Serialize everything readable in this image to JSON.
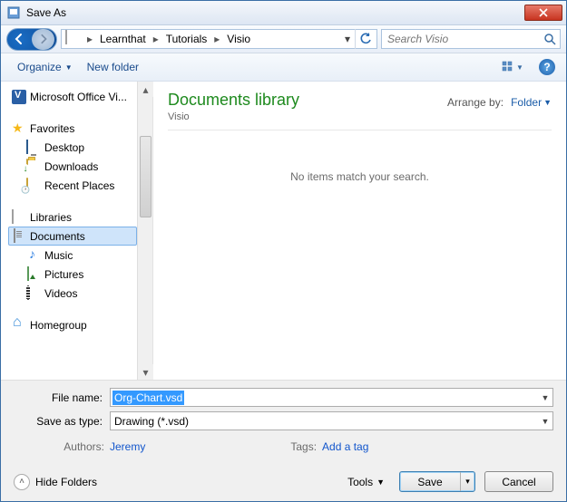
{
  "titlebar": {
    "title": "Save As"
  },
  "nav": {
    "crumbs": [
      "Learnthat",
      "Tutorials",
      "Visio"
    ],
    "search_placeholder": "Search Visio"
  },
  "toolbar": {
    "organize": "Organize",
    "newfolder": "New folder"
  },
  "tree": {
    "top_item": "Microsoft Office Vi...",
    "favorites": "Favorites",
    "fav_items": [
      "Desktop",
      "Downloads",
      "Recent Places"
    ],
    "libraries": "Libraries",
    "lib_items": [
      "Documents",
      "Music",
      "Pictures",
      "Videos"
    ],
    "homegroup": "Homegroup"
  },
  "content": {
    "lib_title": "Documents library",
    "lib_sub": "Visio",
    "arrange_label": "Arrange by:",
    "arrange_value": "Folder",
    "empty": "No items match your search."
  },
  "form": {
    "filename_label": "File name:",
    "filename_value": "Org-Chart.vsd",
    "savetype_label": "Save as type:",
    "savetype_value": "Drawing (*.vsd)",
    "authors_label": "Authors:",
    "authors_value": "Jeremy",
    "tags_label": "Tags:",
    "tags_value": "Add a tag"
  },
  "actions": {
    "hide_folders": "Hide Folders",
    "tools": "Tools",
    "save": "Save",
    "cancel": "Cancel"
  }
}
